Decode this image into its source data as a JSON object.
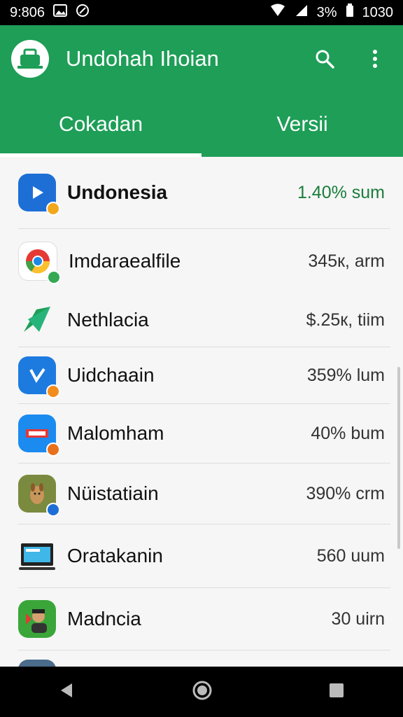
{
  "status": {
    "time": "9:806",
    "battery": "3%",
    "clock": "1030"
  },
  "app": {
    "title": "Undohah Ihoian"
  },
  "tabs": [
    {
      "label": "Cokadan",
      "active": true
    },
    {
      "label": "Versii",
      "active": false
    }
  ],
  "items": [
    {
      "name": "Undonesia",
      "value": "1.40% sum",
      "bold": true,
      "accent": "#1a7d3b",
      "icon": "video-icon"
    },
    {
      "name": "Imdaraealfile",
      "value": "345к, arm",
      "icon": "chrome-icon"
    },
    {
      "name": "Nethlacia",
      "value": "$.25к, tiim",
      "icon": "send-icon"
    },
    {
      "name": "Uidchaain",
      "value": "359% lum",
      "icon": "edit-icon"
    },
    {
      "name": "Malomham",
      "value": "40% bum",
      "icon": "news-icon"
    },
    {
      "name": "Nüistatiain",
      "value": "390% crm",
      "icon": "animal-icon"
    },
    {
      "name": "Oratakanin",
      "value": "560 uum",
      "icon": "laptop-icon"
    },
    {
      "name": "Madncia",
      "value": "30 uirn",
      "icon": "person-icon"
    },
    {
      "name": "",
      "value": "",
      "icon": "person-icon"
    }
  ],
  "colors": {
    "primary": "#1e9e57",
    "accent": "#1a7d3b"
  }
}
